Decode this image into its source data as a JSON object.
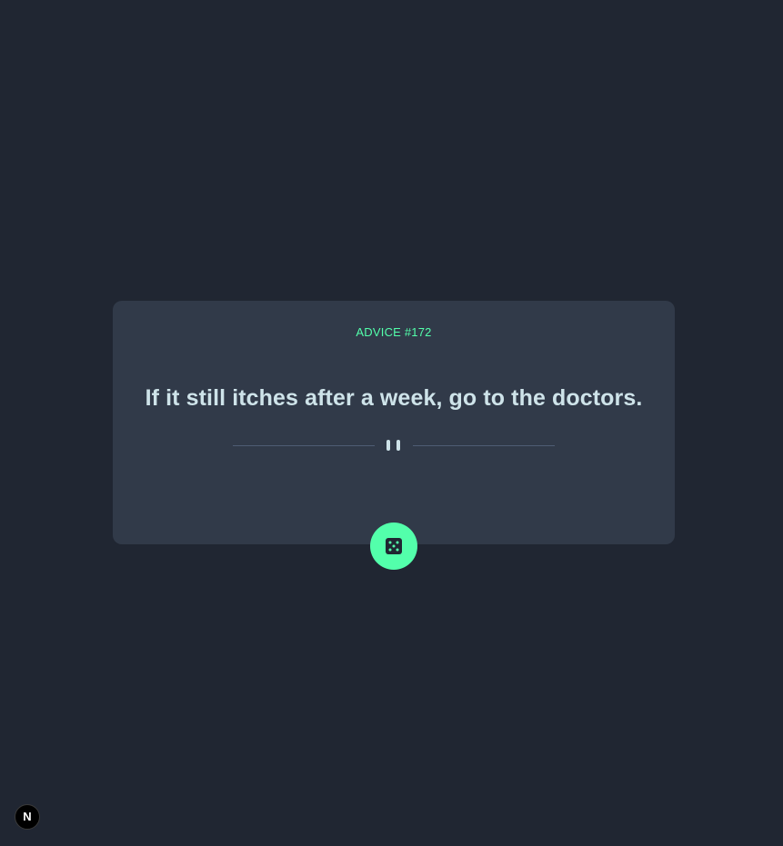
{
  "advice": {
    "label": "ADVICE #172",
    "text": "If it still itches after a week, go to the doctors."
  },
  "dice_button": {
    "icon": "dice-icon"
  },
  "dev_badge": {
    "letter": "N",
    "icon": "nextjs-logo-icon"
  },
  "colors": {
    "background": "#202632",
    "card": "#313a49",
    "accent": "#53ffab",
    "text": "#cee3e9",
    "divider": "#4f5d74"
  }
}
